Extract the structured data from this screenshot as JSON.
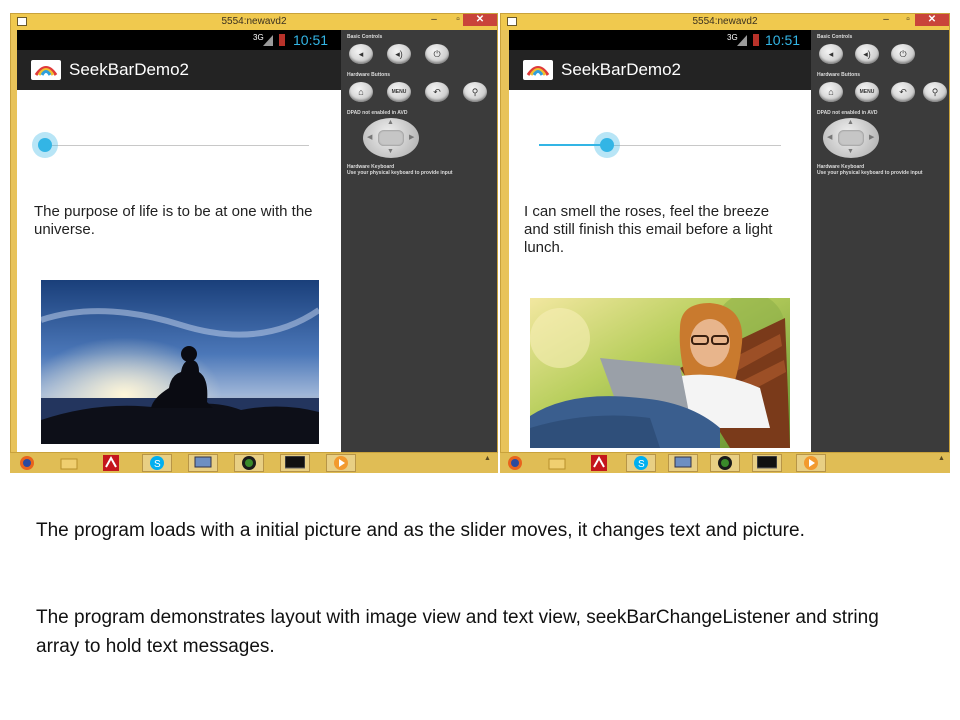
{
  "screens": [
    {
      "window_title": "5554:newavd2",
      "status": {
        "network": "3G",
        "time": "10:51"
      },
      "app_title": "SeekBarDemo2",
      "seekbar": {
        "progress": 0.0
      },
      "message": "The purpose of life is to be at one with the universe.",
      "image": "meditation-silhouette-sunset"
    },
    {
      "window_title": "5554:newavd2",
      "status": {
        "network": "3G",
        "time": "10:51"
      },
      "app_title": "SeekBarDemo2",
      "seekbar": {
        "progress": 0.28
      },
      "message": "I can smell the roses, feel the breeze and still finish this email before a light lunch.",
      "image": "woman-laptop-garden"
    }
  ],
  "emulator_panel": {
    "basic_controls": "Basic Controls",
    "hardware_buttons": "Hardware Buttons",
    "menu_label": "MENU",
    "dpad_note": "DPAD not enabled in AVD",
    "keyboard_title": "Hardware Keyboard",
    "keyboard_note": "Use your physical keyboard to provide input"
  },
  "taskbar_items": [
    "firefox-icon",
    "folder-icon",
    "acrobat-icon",
    "skype-icon",
    "network-icon",
    "amd-icon",
    "terminal-icon",
    "media-icon"
  ],
  "caption": {
    "line1": "The program loads with a initial picture and as the slider moves, it changes text and picture.",
    "line2": "The program demonstrates layout with image view and text view, seekBarChangeListener and string array to hold text messages."
  },
  "colors": {
    "accent": "#33b5e5",
    "window_frame": "#e8c35a",
    "actionbar": "#232323",
    "panel": "#3b3b3b"
  }
}
